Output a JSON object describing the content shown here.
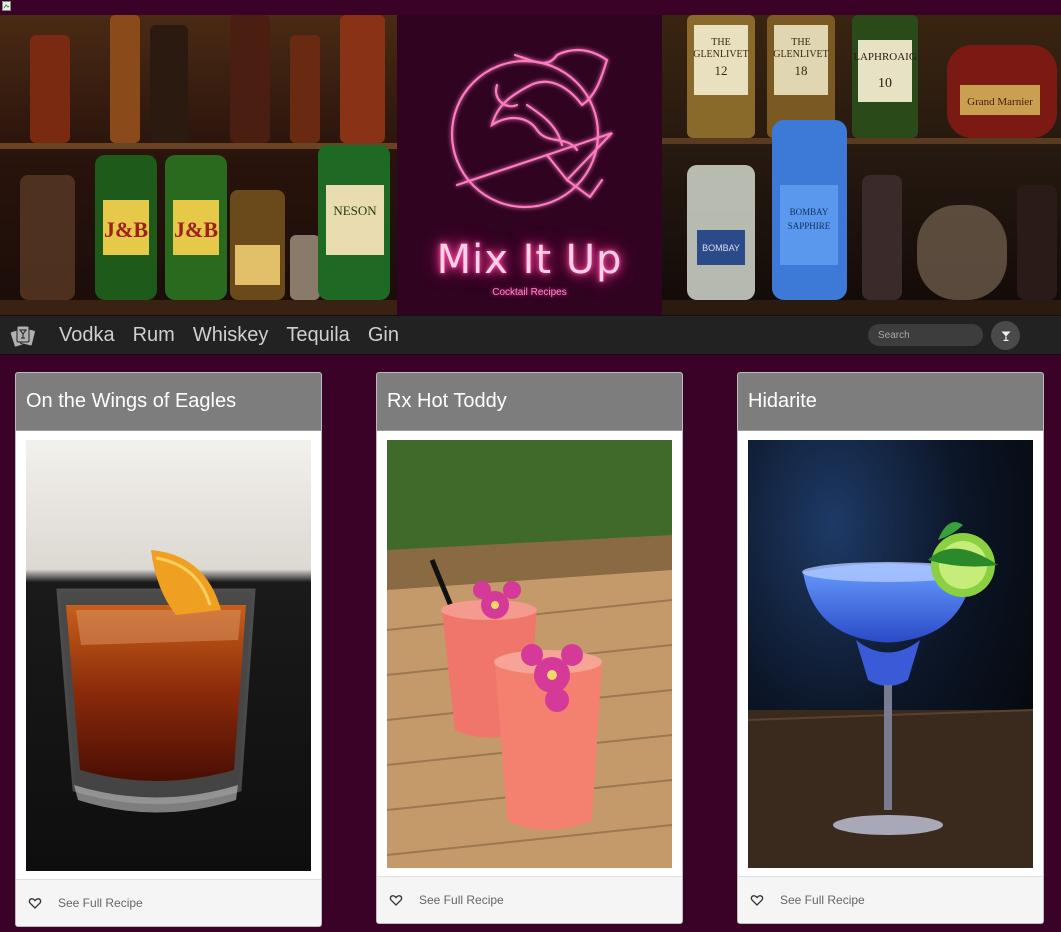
{
  "brand": {
    "title": "Mix It Up",
    "subtitle": "Cocktail Recipes"
  },
  "nav": {
    "logo_icon": "cocktail-cards-icon",
    "links": [
      "Vodka",
      "Rum",
      "Whiskey",
      "Tequila",
      "Gin"
    ],
    "search_placeholder": "Search",
    "search_button_icon": "cocktail-glass-icon"
  },
  "cards": [
    {
      "title": "On the Wings of Eagles",
      "link_label": "See Full Recipe",
      "icon": "heart-icon"
    },
    {
      "title": "Rx Hot Toddy",
      "link_label": "See Full Recipe",
      "icon": "heart-icon"
    },
    {
      "title": "Hidarite",
      "link_label": "See Full Recipe",
      "icon": "heart-icon"
    }
  ],
  "colors": {
    "page_background": "#3a0226",
    "navbar_background": "#222222",
    "card_header": "#7d7d7d",
    "neon_pink": "#ff4aa8"
  }
}
